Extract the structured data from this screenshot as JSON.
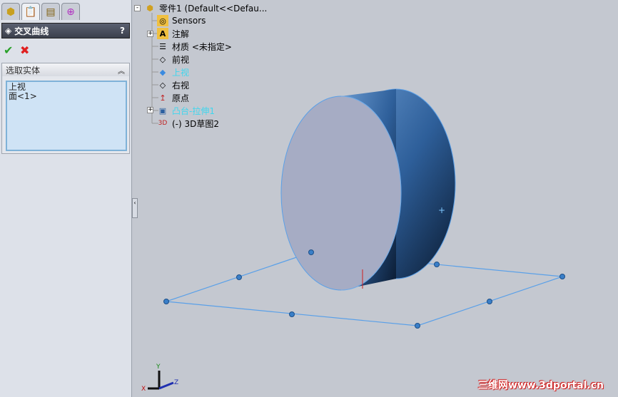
{
  "panel": {
    "title": "交叉曲线",
    "help": "?",
    "ok": "✔",
    "cancel": "✖",
    "group_title": "选取实体",
    "selections": [
      "上视",
      "面<1>"
    ]
  },
  "tree": [
    {
      "label": "零件1  (Default<<Defau...",
      "icon": "part-icon"
    },
    {
      "label": "Sensors",
      "icon": "sensors-icon"
    },
    {
      "label": "注解",
      "icon": "annotations-icon"
    },
    {
      "label": "材质 <未指定>",
      "icon": "material-icon"
    },
    {
      "label": "前视",
      "icon": "plane-icon"
    },
    {
      "label": "上视",
      "icon": "plane-icon",
      "highlighted": true
    },
    {
      "label": "右视",
      "icon": "plane-icon"
    },
    {
      "label": "原点",
      "icon": "origin-icon"
    },
    {
      "label": "凸台-拉伸1",
      "icon": "extrude-icon",
      "highlighted": true
    },
    {
      "label": "(-) 3D草图2",
      "icon": "3dsketch-icon"
    }
  ],
  "triad": {
    "x": "X",
    "y": "Y",
    "z": "Z"
  },
  "watermark": "三维网www.3dportal.cn",
  "colors": {
    "viewport": "#c4c8d0",
    "highlight": "#3fd6ee",
    "sketch": "#5aa0e8"
  }
}
